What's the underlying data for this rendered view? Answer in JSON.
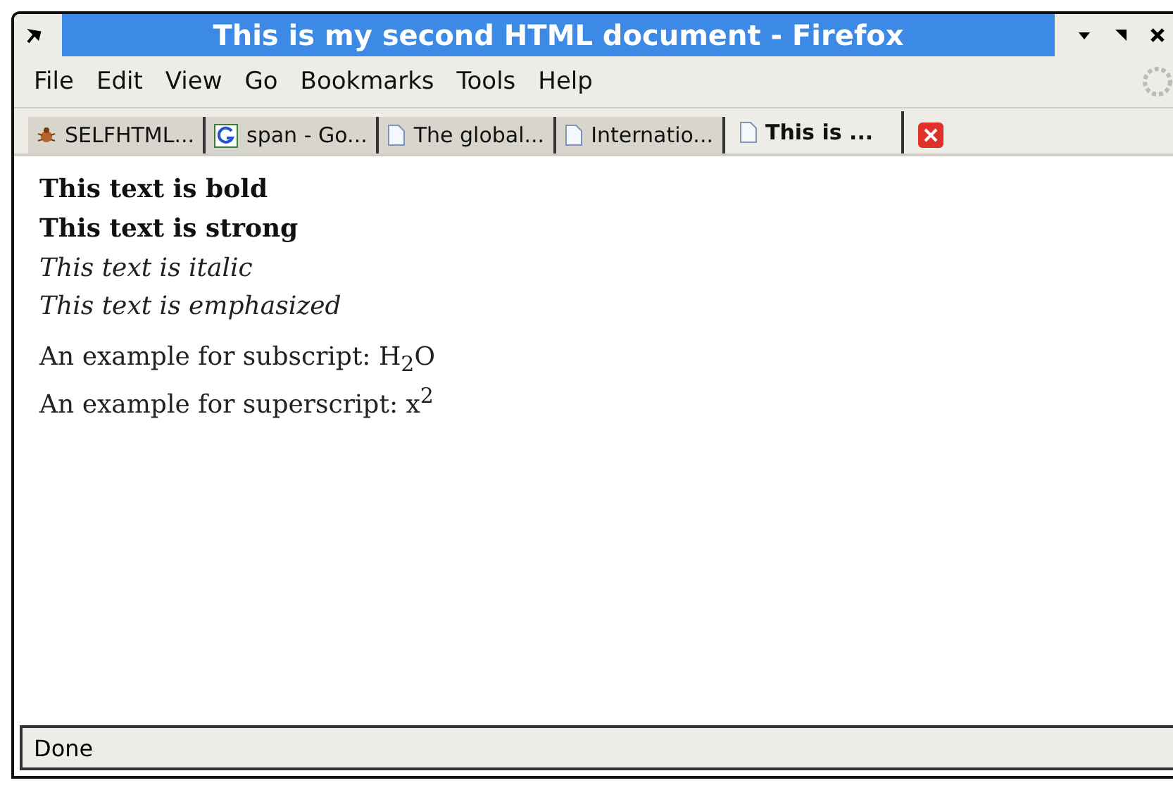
{
  "window": {
    "title": "This is my second HTML document - Firefox"
  },
  "menu": [
    "File",
    "Edit",
    "View",
    "Go",
    "Bookmarks",
    "Tools",
    "Help"
  ],
  "tabs": [
    {
      "label": "SELFHTML...",
      "kind": "bug",
      "selected": false
    },
    {
      "label": "span - Go...",
      "kind": "g",
      "selected": false
    },
    {
      "label": "The global...",
      "kind": "page",
      "selected": false
    },
    {
      "label": "Internatio...",
      "kind": "page",
      "selected": false
    },
    {
      "label": "This is ...",
      "kind": "page",
      "selected": true
    }
  ],
  "content": [
    {
      "kind": "bold",
      "text": "This text is bold"
    },
    {
      "kind": "bold",
      "text": "This text is strong"
    },
    {
      "kind": "italic",
      "text": "This text is italic"
    },
    {
      "kind": "italic",
      "text": "This text is emphasized"
    },
    {
      "kind": "para",
      "text": "An example for subscript: H$_{2}$O"
    },
    {
      "kind": "para",
      "text": "An example for superscript: x$^{2}$"
    }
  ],
  "status_bar": "Done"
}
